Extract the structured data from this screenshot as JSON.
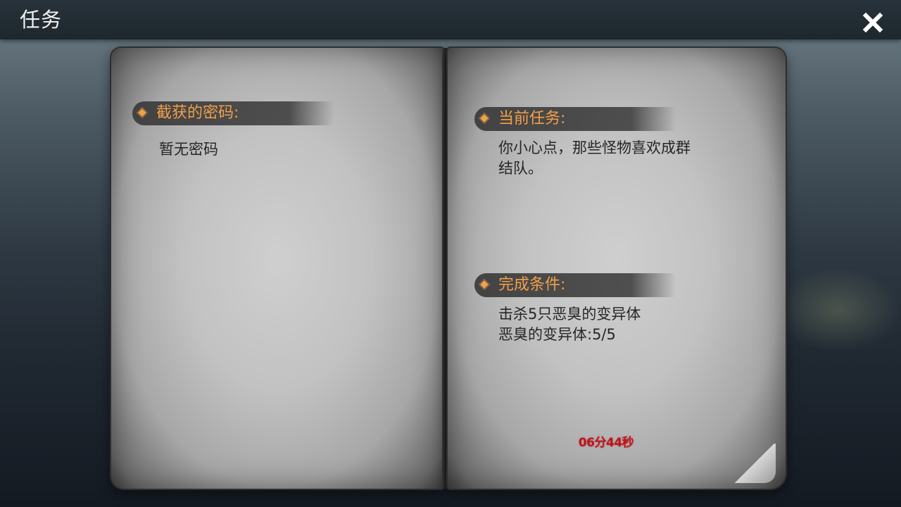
{
  "window": {
    "title": "任务",
    "close_label": "X",
    "close_icon": "close-icon"
  },
  "left_page": {
    "codes_header": "截获的密码:",
    "codes_text": "暂无密码"
  },
  "right_page": {
    "current_task_header": "当前任务:",
    "current_task_line1": "你小心点，那些怪物喜欢成群",
    "current_task_line2": "结队。",
    "conditions_header": "完成条件:",
    "condition_line1": "击杀5只恶臭的变异体",
    "condition_line2": "恶臭的变异体:5/5",
    "timer": "06分44秒"
  },
  "colors": {
    "accent": "#f1a04a",
    "timer": "#c1121b",
    "top_bar": "#1e272e"
  }
}
